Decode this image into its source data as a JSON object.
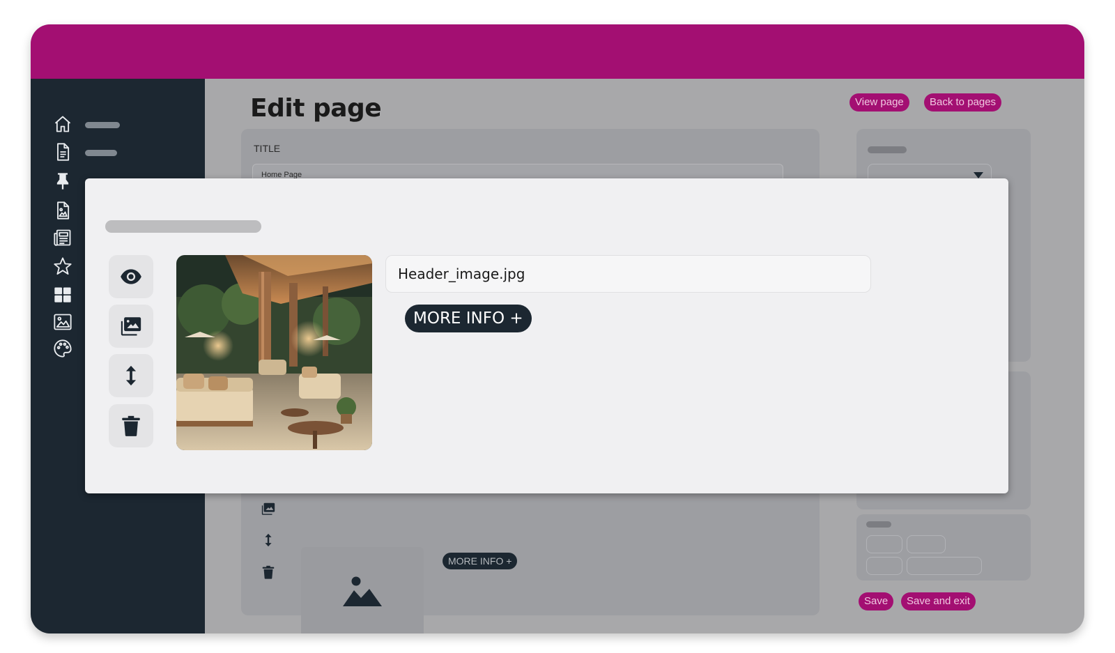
{
  "colors": {
    "brand": "#a30f72",
    "sidebar": "#1c2731",
    "overlay": "#a8a8aa",
    "modal": "#f0f0f2"
  },
  "page": {
    "title": "Edit page",
    "view_page_label": "View page",
    "back_to_pages_label": "Back to pages",
    "save_label": "Save",
    "save_and_exit_label": "Save and exit"
  },
  "form": {
    "title_label": "TITLE",
    "title_value": "Home Page",
    "more_info_label": "MORE INFO +"
  },
  "sidebar": {
    "icons": [
      "home-icon",
      "document-icon",
      "pin-icon",
      "image-file-icon",
      "newspaper-icon",
      "star-icon",
      "grid-icon",
      "gallery-icon",
      "palette-icon"
    ]
  },
  "modal": {
    "filename": "Header_image.jpg",
    "more_info_label": "MORE INFO +",
    "tools": [
      "eye-icon",
      "images-icon",
      "move-vertical-icon",
      "trash-icon"
    ]
  }
}
